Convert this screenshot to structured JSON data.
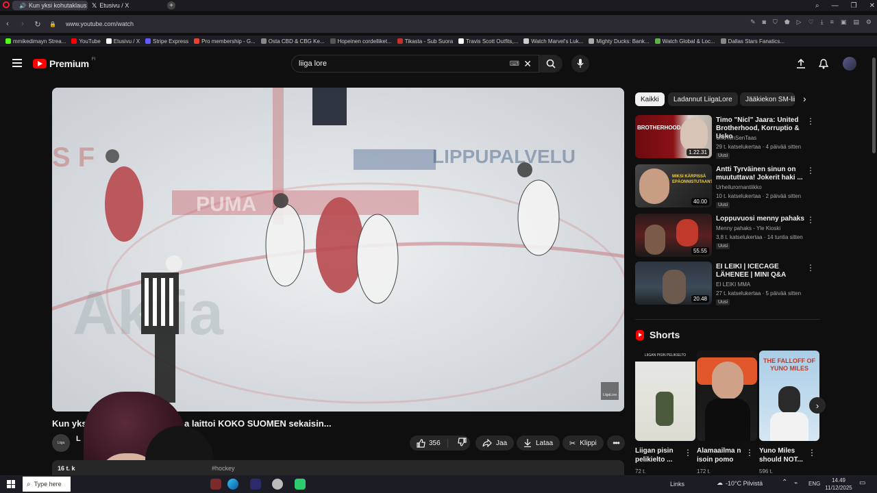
{
  "browser": {
    "tabs": [
      {
        "label": "Kun yksi kohutaklaus"
      },
      {
        "label": "Etusivu / X"
      }
    ],
    "url": "www.youtube.com/watch",
    "bookmarks": [
      {
        "label": "mmikedimayn Strea...",
        "color": "#53fc18"
      },
      {
        "label": "YouTube",
        "color": "#ff0000"
      },
      {
        "label": "Etusivu / X",
        "color": "#ffffff"
      },
      {
        "label": "Stripe Express",
        "color": "#635bff"
      },
      {
        "label": "Pro membership - G...",
        "color": "#e94235"
      },
      {
        "label": "Osta CBD & CBG Ke...",
        "color": "#888888"
      },
      {
        "label": "Hopeinen cordelliket...",
        "color": "#555555"
      },
      {
        "label": "Tikasta - Sub Suora",
        "color": "#c4302b"
      },
      {
        "label": "Travis Scott Outfits,...",
        "color": "#ffffff"
      },
      {
        "label": "Watch Marvel's Luk...",
        "color": "#cccccc"
      },
      {
        "label": "Mighty Ducks: Bank...",
        "color": "#aaaaaa"
      },
      {
        "label": "Watch Global & Loc...",
        "color": "#5fb04a"
      },
      {
        "label": "Dallas Stars Fanatics...",
        "color": "#888888"
      }
    ]
  },
  "youtube": {
    "logo_text": "Premium",
    "logo_region": "FI",
    "search_value": "liiga lore",
    "video": {
      "title": "Kun yksi kohutaklaus laittoi KOKO SUOMEN sekaisin...",
      "title_visible_start": "Kun yks",
      "title_visible_end": "a laittoi KOKO SUOMEN sekaisin...",
      "channel_initial": "L",
      "watermark": "LiigaLore",
      "likes": "356",
      "share_label": "Jaa",
      "download_label": "Lataa",
      "clip_label": "Klippi",
      "desc_views": "16 t. k",
      "desc_tag": "#hockey"
    },
    "chips": [
      "Kaikki",
      "Ladannut LiigaLore",
      "Jääkiekon SM-lii"
    ],
    "recommendations": [
      {
        "title": "Timo \"Nicl\" Jaara: United Brotherhood, Korruptio & Usko",
        "channel": "OhoTenSenTaas",
        "meta": "29 t. katselukertaa · 4 päivää sitten",
        "badge": "Uusi",
        "duration": "1.22.31",
        "thumb_text": "BROTHERHOOD"
      },
      {
        "title": "Antti Tyrväinen sinun on muututtava! Jokerit haki ...",
        "channel": "Urheilurornantiikko",
        "meta": "10 t. katselukertaa · 2 päivää sitten",
        "badge": "Uusi",
        "duration": "40.00",
        "thumb_text": "MIKSI KÄRPISSÄ EPÄONNISTUTAAN?"
      },
      {
        "title": "Loppuvuosi menny pahaks",
        "channel": "Menny pahaks - Yle Kioski",
        "meta": "3,8 t. katselukertaa · 14 tuntia sitten",
        "badge": "Uusi",
        "duration": "55.55",
        "thumb_text": ""
      },
      {
        "title": "EI LEIKI | ICECAGE LÄHENEE | MINI Q&A",
        "channel": "EI LEIKI MMA",
        "meta": "27 t. katselukertaa · 5 päivää sitten",
        "badge": "Uusi",
        "duration": "20.48",
        "thumb_text": ""
      }
    ],
    "shorts_title": "Shorts",
    "shorts": [
      {
        "title": "Liigan pisin pelikielto ...",
        "views": "72 t.",
        "thumb_text": "LIIGAN PISIN PELIKIELTO"
      },
      {
        "title": "Alamaailma n isoin pomo",
        "views": "172 t.",
        "thumb_text": ""
      },
      {
        "title": "Yuno Miles should NOT...",
        "views": "596 t.",
        "thumb_text": "THE FALLOFF OF YUNO MILES"
      }
    ]
  },
  "taskbar": {
    "search_placeholder": "Type here",
    "links_label": "Links",
    "weather": "-10°C Pilvistä",
    "lang": "ENG",
    "time": "14.49",
    "date": "11/12/2025"
  },
  "colors": {
    "yt_red": "#ff0000",
    "bg": "#0f0f0f",
    "chip_active": "#f1f1f1"
  }
}
